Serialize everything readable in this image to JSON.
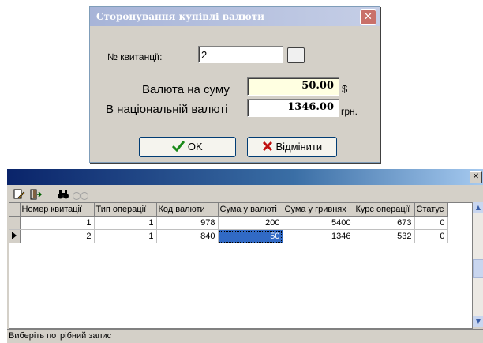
{
  "dialog": {
    "title": "Сторонування купівлі валюти",
    "receipt_label": "№ квитанції:",
    "receipt_value": "2",
    "amount_label": "Валюта на суму",
    "amount_value": "50.00",
    "amount_unit": "$",
    "national_label": "В національній валюті",
    "national_value": "1346.00",
    "national_unit": "грн.",
    "ok_label": "OK",
    "cancel_label": "Відмінити",
    "ok_icon": "checkmark-icon",
    "cancel_icon": "x-icon"
  },
  "grid_window": {
    "toolbar_icons": [
      "edit-icon",
      "exit-icon",
      "binoculars-icon",
      "glasses-icon"
    ],
    "columns": [
      "Номер квитації",
      "Тип операції",
      "Код валюти",
      "Сума у валюті",
      "Сума у гривнях",
      "Курс операції",
      "Статус"
    ],
    "rows": [
      [
        "1",
        "1",
        "978",
        "200",
        "5400",
        "673",
        "0"
      ],
      [
        "2",
        "1",
        "840",
        "50",
        "1346",
        "532",
        "0"
      ]
    ],
    "selected_row": 1,
    "status_text": "Виберіть потрібний запис"
  }
}
